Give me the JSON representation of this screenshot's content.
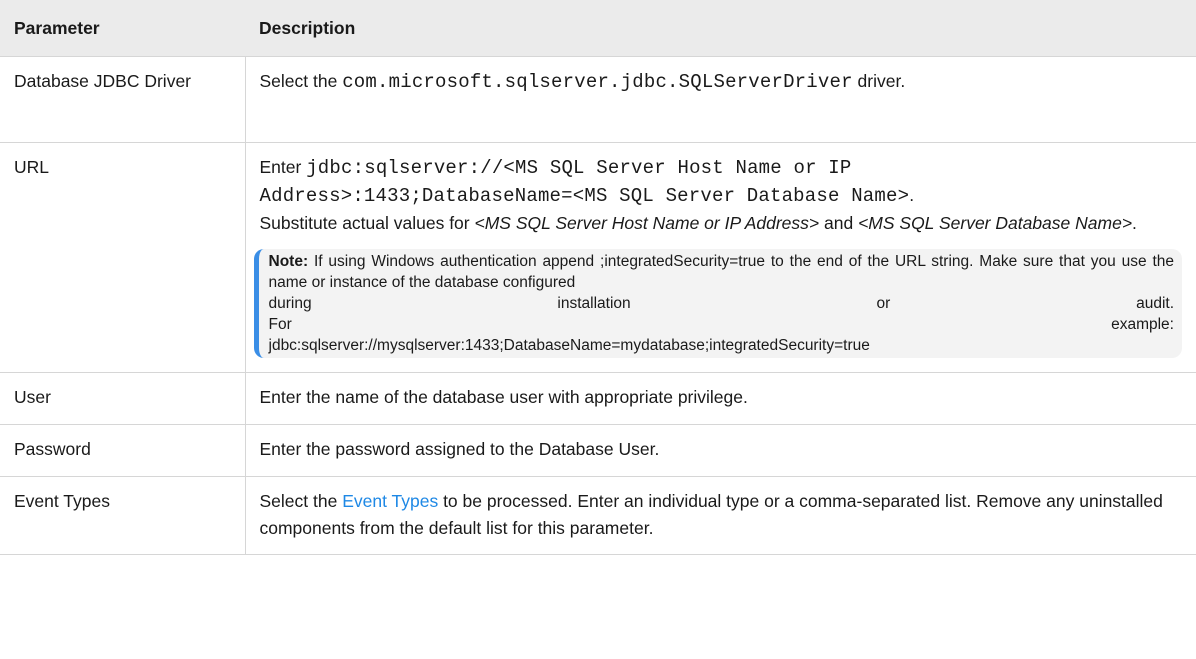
{
  "table": {
    "headers": {
      "parameter": "Parameter",
      "description": "Description"
    },
    "rows": {
      "driver": {
        "param": "Database JDBC Driver",
        "desc_before": "Select the ",
        "desc_code": "com.microsoft.sqlserver.jdbc.SQLServerDriver",
        "desc_after": " driver."
      },
      "url": {
        "param": "URL",
        "desc_enter": "Enter ",
        "desc_code_1": "jdbc:sqlserver://<MS SQL Server Host Name or IP",
        "desc_code_2": "Address>:1433;DatabaseName=<MS SQL Server Database Name>",
        "desc_period": ".",
        "desc_sub_before": "Substitute actual values for ",
        "desc_sub_italic_1": "<MS SQL Server Host Name or IP Address>",
        "desc_sub_and": " and ",
        "desc_sub_italic_2": "<MS SQL Server Database Name>",
        "desc_sub_end": ".",
        "note": {
          "label": "Note:",
          "line1": " If using Windows authentication append ;integratedSecurity=true to the end of the URL string. Make sure that you use the name or instance of the database configured",
          "line2_words": [
            "during",
            "installation",
            "or",
            "audit."
          ],
          "line3_words": [
            "For",
            "example:"
          ],
          "line4": "jdbc:sqlserver://mysqlserver:1433;DatabaseName=mydatabase;integratedSecurity=true"
        }
      },
      "user": {
        "param": "User",
        "desc": "Enter the name of the database user with appropriate privilege."
      },
      "password": {
        "param": "Password",
        "desc": "Enter the password assigned to the Database User."
      },
      "event_types": {
        "param": "Event Types",
        "desc_before": "Select the ",
        "desc_link": "Event Types",
        "desc_after": " to be processed. Enter an individual type or a comma-separated list. Remove any uninstalled components from the default list for this parameter."
      }
    }
  },
  "colors": {
    "header_bg": "#ebebeb",
    "border": "#d6d6d6",
    "link": "#1e88e5",
    "note_accent": "#3a8ee6",
    "note_bg": "#f3f3f3"
  }
}
